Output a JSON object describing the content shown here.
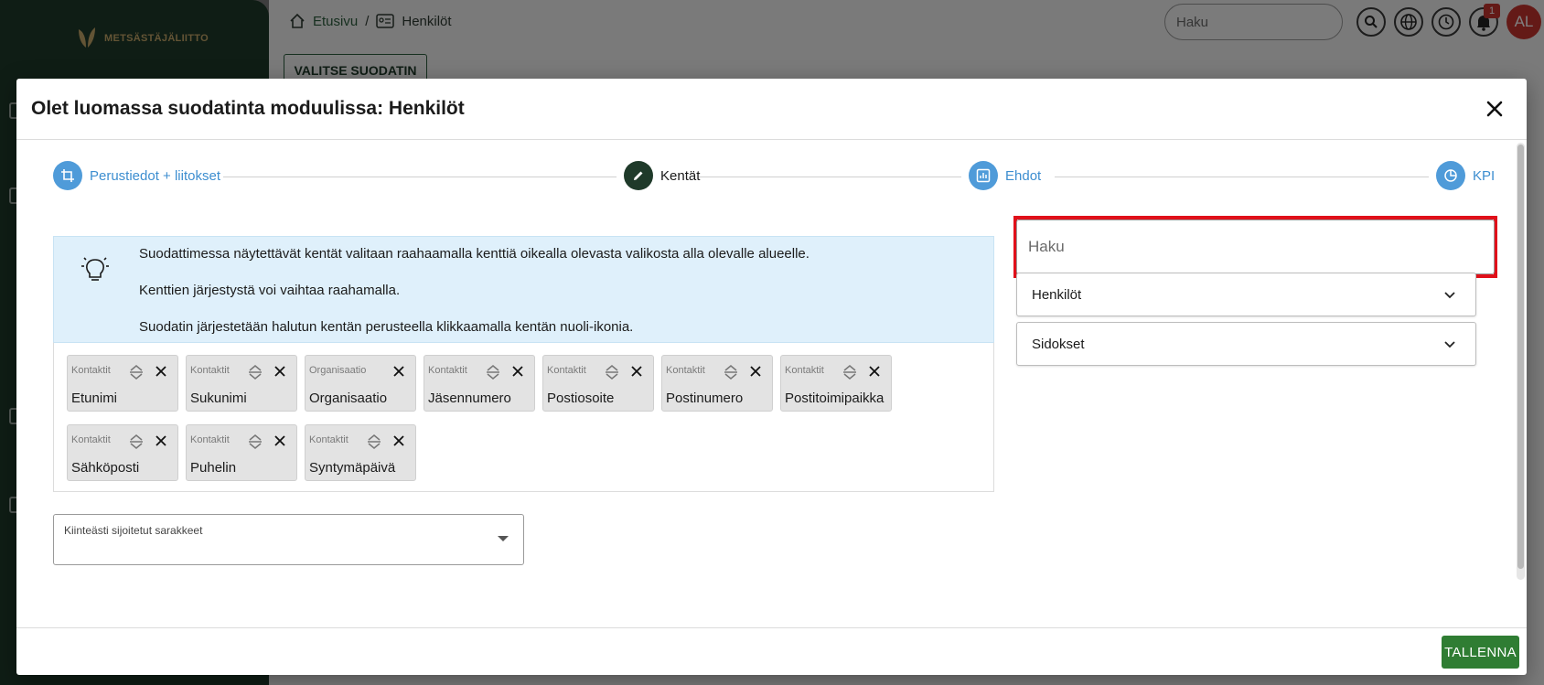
{
  "background": {
    "logo_text": "METSÄSTÄJÄLIITTO",
    "breadcrumb": {
      "home": "Etusivu",
      "separator": "/",
      "current": "Henkilöt"
    },
    "search_placeholder": "Haku",
    "notification_count": "1",
    "avatar_initials": "AL",
    "filter_button": "VALITSE SUODATIN"
  },
  "modal": {
    "title": "Olet luomassa suodatinta moduulissa: Henkilöt",
    "stepper": [
      {
        "label": "Perustiedot + liitokset",
        "state": "inactive",
        "icon": "crop-icon"
      },
      {
        "label": "Kentät",
        "state": "active",
        "icon": "pencil-icon"
      },
      {
        "label": "Ehdot",
        "state": "inactive",
        "icon": "chart-icon"
      },
      {
        "label": "KPI",
        "state": "inactive",
        "icon": "pie-chart-icon"
      }
    ],
    "info": {
      "line1": "Suodattimessa näytettävät kentät valitaan raahaamalla kenttiä oikealla olevasta valikosta alla olevalle alueelle.",
      "line2": "Kenttien järjestystä voi vaihtaa raahamalla.",
      "line3": "Suodatin järjestetään halutun kentän perusteella klikkaamalla kentän nuoli-ikonia."
    },
    "fields": [
      {
        "category": "Kontaktit",
        "name": "Etunimi"
      },
      {
        "category": "Kontaktit",
        "name": "Sukunimi"
      },
      {
        "category": "Organisaatio",
        "name": "Organisaatio"
      },
      {
        "category": "Kontaktit",
        "name": "Jäsennumero"
      },
      {
        "category": "Kontaktit",
        "name": "Postiosoite"
      },
      {
        "category": "Kontaktit",
        "name": "Postinumero"
      },
      {
        "category": "Kontaktit",
        "name": "Postitoimipaikka"
      },
      {
        "category": "Kontaktit",
        "name": "Sähköposti"
      },
      {
        "category": "Kontaktit",
        "name": "Puhelin"
      },
      {
        "category": "Kontaktit",
        "name": "Syntymäpäivä"
      }
    ],
    "fixed_columns_label": "Kiinteästi sijoitetut sarakkeet",
    "field_search_placeholder": "Haku",
    "accordions": [
      "Henkilöt",
      "Sidokset"
    ],
    "save_button": "TALLENNA"
  },
  "colors": {
    "brand_dark_green": "#1f3a2a",
    "step_blue": "#4f9bd9",
    "save_green": "#2f7d33",
    "highlight_red": "#e0101a",
    "info_blue": "#dff0fb"
  }
}
